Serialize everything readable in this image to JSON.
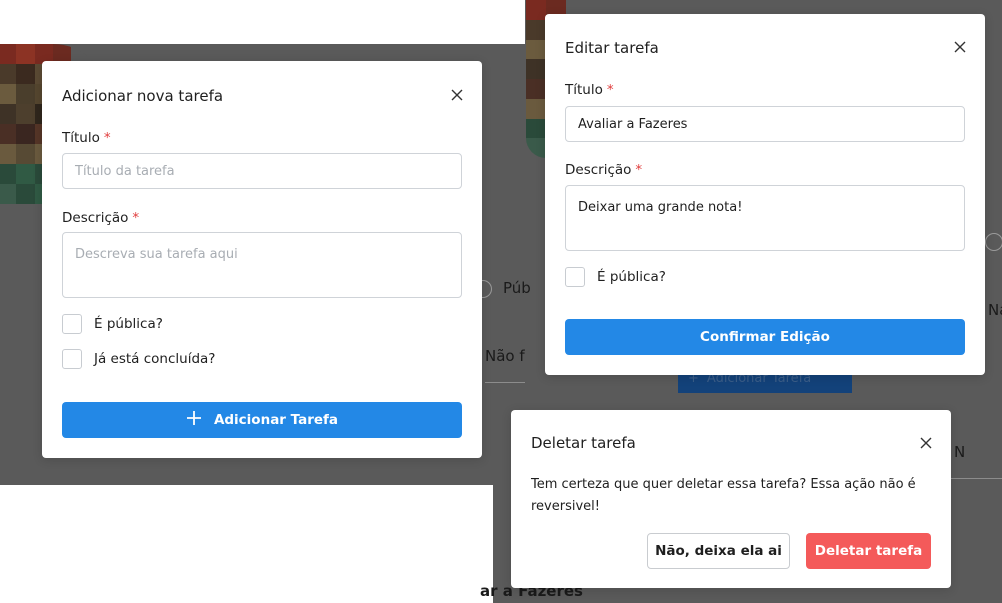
{
  "background": {
    "text_radio_public": "Púb",
    "text_not_done": "Não f",
    "text_add_task_button": "Adicionar Tarefa",
    "text_na_1": "Na",
    "text_na_2": "N",
    "text_evaluate_fazeres": "ar a Fazeres"
  },
  "add_task_modal": {
    "title": "Adicionar nova tarefa",
    "title_label": "Título",
    "title_placeholder": "Título da tarefa",
    "description_label": "Descrição",
    "description_placeholder": "Descreva sua tarefa aqui",
    "public_label": "É pública?",
    "completed_label": "Já está concluída?",
    "submit_label": "Adicionar Tarefa"
  },
  "edit_task_modal": {
    "title": "Editar tarefa",
    "title_label": "Título",
    "title_value": "Avaliar a Fazeres",
    "description_label": "Descrição",
    "description_value": "Deixar uma grande nota!",
    "public_label": "É pública?",
    "submit_label": "Confirmar Edição"
  },
  "delete_task_modal": {
    "title": "Deletar tarefa",
    "message": "Tem certeza que quer deletar essa tarefa? Essa ação não é reversivel!",
    "cancel_label": "Não, deixa ela ai",
    "confirm_label": "Deletar tarefa"
  },
  "required_marker": "*",
  "colors": {
    "primary": "#2388e6",
    "danger": "#f45a5a",
    "required": "#e03c3c",
    "backdrop": "#5a5a5a"
  }
}
